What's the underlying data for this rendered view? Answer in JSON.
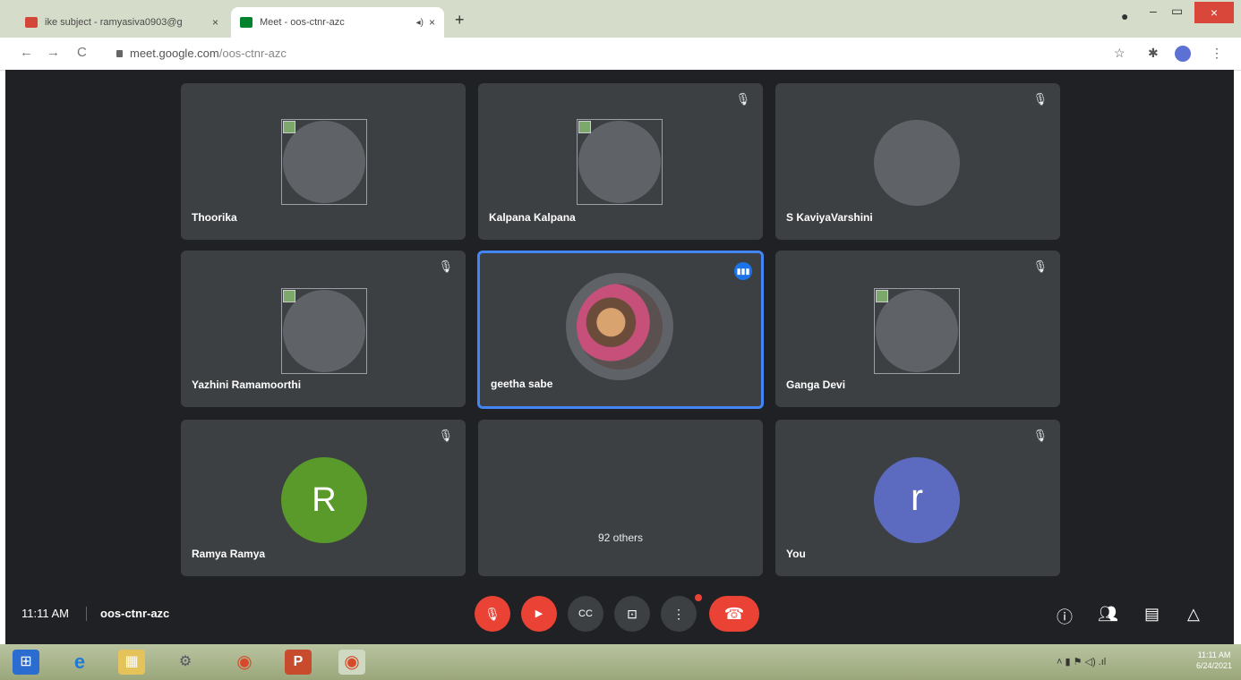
{
  "browser": {
    "tabs": [
      {
        "title": "ike subject - ramyasiva0903@g",
        "close": "×",
        "favicon_color": "#d44638"
      },
      {
        "title": "Meet - oos-ctnr-azc",
        "close": "×",
        "favicon_color": "#00832d",
        "audio": "◂)"
      }
    ],
    "new_tab": "+",
    "window": {
      "minimize": "–",
      "restore": "▭",
      "close": "×"
    },
    "nav": {
      "back": "←",
      "forward": "→",
      "reload": "C"
    },
    "url_host": "meet.google.com",
    "url_path": "/oos-ctnr-azc",
    "icons": {
      "star": "☆",
      "extensions": "✱",
      "menu": "⋮"
    }
  },
  "meet": {
    "tiles": [
      {
        "name": "Thoorika",
        "muted": true
      },
      {
        "name": "Kalpana Kalpana",
        "muted": true
      },
      {
        "name": "S KaviyaVarshini",
        "muted": true
      },
      {
        "name": "Yazhini Ramamoorthi",
        "muted": true
      },
      {
        "name": "geetha sabe",
        "speaking": true
      },
      {
        "name": "Ganga Devi",
        "muted": true
      },
      {
        "name": "Ramya Ramya",
        "muted": true,
        "initial": "R",
        "avatar_color": "#5a9a2a"
      },
      {
        "others": "92 others"
      },
      {
        "name": "You",
        "muted": true,
        "initial": "r",
        "avatar_color": "#5c6bc0"
      }
    ],
    "mic_off_glyph": "🎙︎",
    "bottom": {
      "time": "11:11 AM",
      "meeting_code": "oos-ctnr-azc",
      "controls": {
        "mic": "🎙︎",
        "camera": "▶︎",
        "captions": "CC",
        "present": "⊡",
        "more": "⋮",
        "end": "☎︎"
      },
      "right_icons": {
        "info": "ⓘ",
        "people": "👥︎",
        "chat": "▤",
        "activities": "△"
      }
    }
  },
  "taskbar": {
    "apps": [
      "⊞",
      "e",
      "▦",
      "⚙",
      "◉",
      "P",
      "◉"
    ],
    "tray_icons": "˄  ▮  ⚑  ◁)  .ıl",
    "time": "11:11 AM",
    "date": "6/24/2021"
  }
}
